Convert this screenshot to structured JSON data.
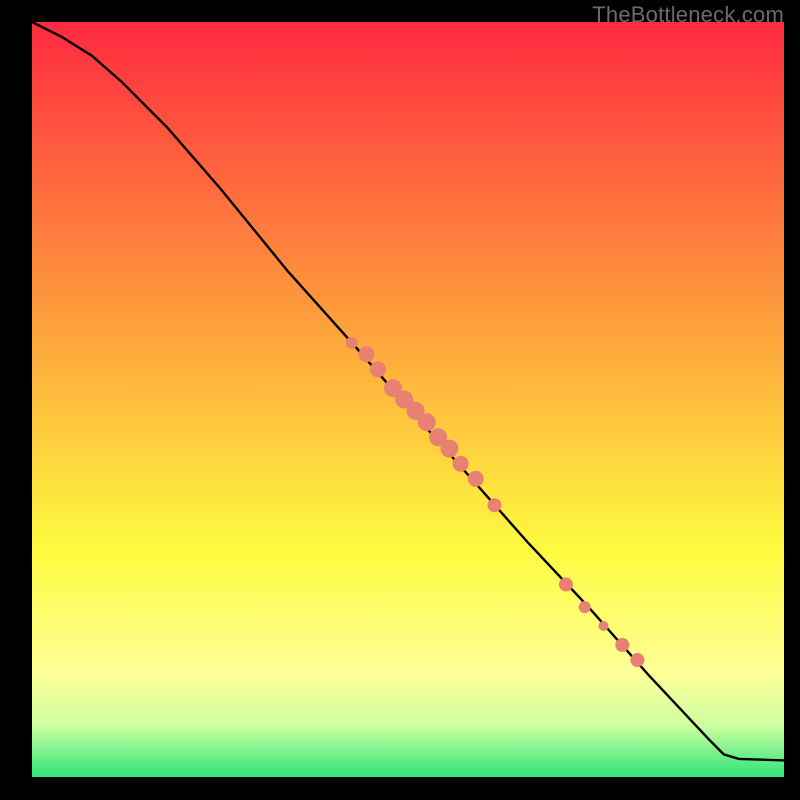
{
  "watermark": "TheBottleneck.com",
  "colors": {
    "gradient_top": "#fe2a3f",
    "gradient_mid1": "#fea63c",
    "gradient_mid2": "#fefb3f",
    "gradient_mid3": "#feff96",
    "gradient_mid4": "#d0ffa0",
    "gradient_bottom": "#2fe57a",
    "curve": "#000000",
    "dot": "#e88074",
    "bg": "#000000"
  },
  "chart_data": {
    "type": "line",
    "title": "",
    "xlabel": "",
    "ylabel": "",
    "xlim": [
      0,
      100
    ],
    "ylim": [
      0,
      100
    ],
    "grid": false,
    "legend": false,
    "curve": [
      {
        "x": 0,
        "y": 100
      },
      {
        "x": 4,
        "y": 98
      },
      {
        "x": 8,
        "y": 95.5
      },
      {
        "x": 12,
        "y": 92
      },
      {
        "x": 18,
        "y": 86
      },
      {
        "x": 25,
        "y": 78
      },
      {
        "x": 34,
        "y": 67
      },
      {
        "x": 43,
        "y": 57
      },
      {
        "x": 50,
        "y": 49
      },
      {
        "x": 58,
        "y": 40
      },
      {
        "x": 66,
        "y": 31
      },
      {
        "x": 74,
        "y": 22.5
      },
      {
        "x": 82,
        "y": 13.5
      },
      {
        "x": 90,
        "y": 5
      },
      {
        "x": 92,
        "y": 3
      },
      {
        "x": 94,
        "y": 2.4
      },
      {
        "x": 100,
        "y": 2.2
      }
    ],
    "dots": [
      {
        "x": 42.5,
        "y": 57.5,
        "r": 6
      },
      {
        "x": 44.5,
        "y": 56.0,
        "r": 8
      },
      {
        "x": 46.0,
        "y": 54.0,
        "r": 8
      },
      {
        "x": 48.0,
        "y": 51.5,
        "r": 9
      },
      {
        "x": 49.5,
        "y": 50.0,
        "r": 9
      },
      {
        "x": 51.0,
        "y": 48.5,
        "r": 9
      },
      {
        "x": 52.5,
        "y": 47.0,
        "r": 9
      },
      {
        "x": 54.0,
        "y": 45.0,
        "r": 9
      },
      {
        "x": 55.5,
        "y": 43.5,
        "r": 9
      },
      {
        "x": 57.0,
        "y": 41.5,
        "r": 8
      },
      {
        "x": 59.0,
        "y": 39.5,
        "r": 8
      },
      {
        "x": 61.5,
        "y": 36.0,
        "r": 7
      },
      {
        "x": 71.0,
        "y": 25.5,
        "r": 7
      },
      {
        "x": 73.5,
        "y": 22.5,
        "r": 6
      },
      {
        "x": 76.0,
        "y": 20.0,
        "r": 5
      },
      {
        "x": 78.5,
        "y": 17.5,
        "r": 7
      },
      {
        "x": 80.5,
        "y": 15.5,
        "r": 7
      }
    ]
  }
}
